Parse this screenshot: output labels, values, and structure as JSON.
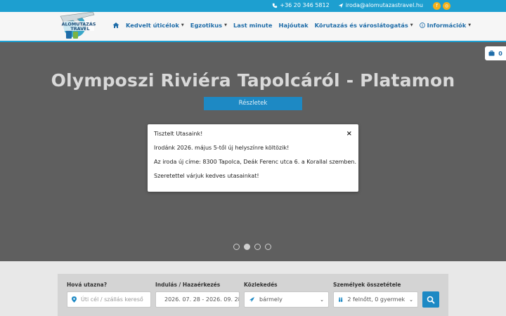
{
  "topbar": {
    "phone": "+36 20 346 5812",
    "email": "iroda@alomutazastravel.hu",
    "social": [
      {
        "icon": "facebook-icon",
        "glyph": "f"
      },
      {
        "icon": "instagram-icon",
        "glyph": "◎"
      }
    ]
  },
  "logo": {
    "line1": "ÁLOMUTAZÁS",
    "line2": "TRAVEL"
  },
  "nav": {
    "items": [
      {
        "label": "Kedvelt úticélok",
        "dropdown": true
      },
      {
        "label": "Egzotikus",
        "dropdown": true
      },
      {
        "label": "Last minute",
        "dropdown": false
      },
      {
        "label": "Hajóutak",
        "dropdown": false
      },
      {
        "label": "Körutazás és városlátogatás",
        "dropdown": true
      },
      {
        "label": "Információk",
        "dropdown": true
      }
    ]
  },
  "hero": {
    "title": "Olymposzi Riviéra Tapolcáról - Platamon",
    "button": "Részletek",
    "cart_count": "0",
    "slides": 4,
    "active_slide": 2
  },
  "modal": {
    "title": "Tisztelt Utasaink!",
    "close": "×",
    "line1": "Irodánk 2026. május 5-től új helyszínre költözik!",
    "line2": "Az iroda új címe: 8300 Tapolca, Deák Ferenc utca 6. a Korallal szemben.",
    "line3": "Szeretettel várjuk kedves utasainkat!"
  },
  "search": {
    "dest_label": "Hová utazna?",
    "dest_placeholder": "Úti cél / szállás kereső",
    "date_label": "Indulás / Hazaérkezés",
    "date_value": "2026. 07. 28 - 2026. 09. 28",
    "transport_label": "Közlekedés",
    "transport_value": "bármely",
    "persons_label": "Személyek összetétele",
    "persons_value": "2 felnőtt, 0 gyermek"
  },
  "colors": {
    "accent": "#1d9fd0",
    "button": "#1d89c4",
    "nav_text": "#1e6ca8",
    "social": "#f3b01b"
  }
}
